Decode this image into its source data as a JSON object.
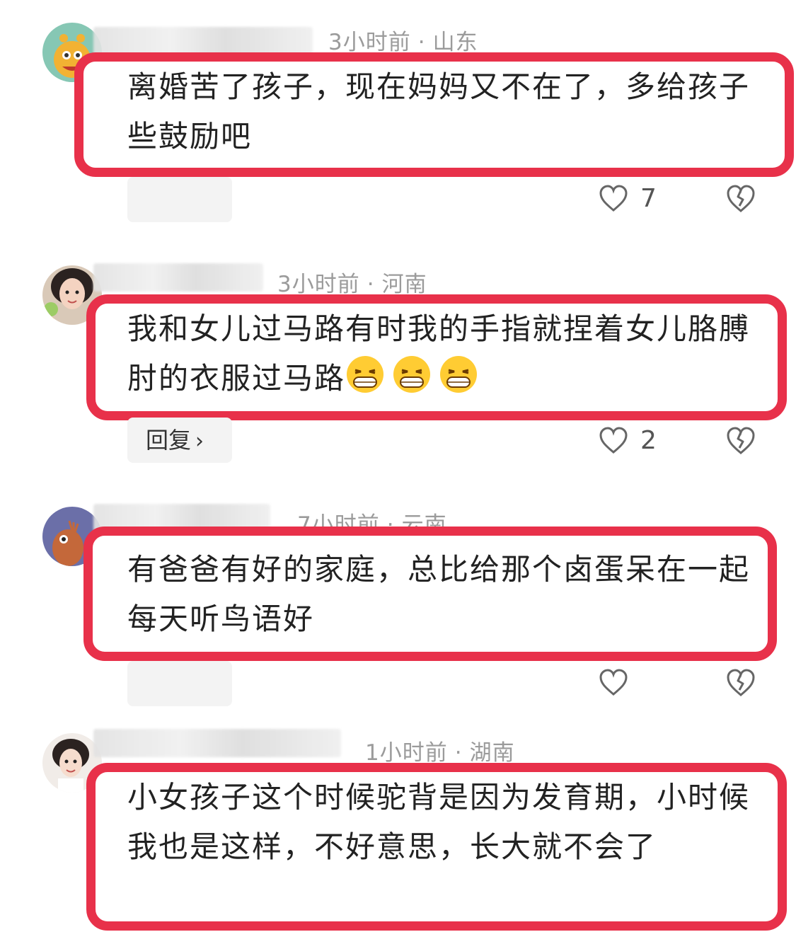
{
  "comments": [
    {
      "time": "3小时前",
      "location": "山东",
      "text": "离婚苦了孩子，现在妈妈又不在了，多给孩子些鼓励吧",
      "like_count": "7",
      "reply_label": ""
    },
    {
      "time": "3小时前",
      "location": "河南",
      "text": "我和女儿过马路有时我的手指就捏着女儿胳膊肘的衣服过马路",
      "like_count": "2",
      "reply_label": "回复",
      "emoji_name": "grinning-squint-emoji"
    },
    {
      "time": "7小时前",
      "location": "云南",
      "text": "有爸爸有好的家庭，总比给那个卤蛋呆在一起每天听鸟语好",
      "like_count": "",
      "reply_label": ""
    },
    {
      "time": "1小时前",
      "location": "湖南",
      "text": "小女孩子这个时候驼背是因为发育期，小时候我也是这样，不好意思，长大就不会了"
    }
  ],
  "colors": {
    "highlight_border": "#e8314a",
    "meta_text": "#9b9b9b",
    "reply_pill_bg": "#f3f3f3"
  },
  "icons": {
    "like": "heart-outline-icon",
    "dislike": "broken-heart-icon",
    "reply_chevron": "chevron-right-icon"
  }
}
